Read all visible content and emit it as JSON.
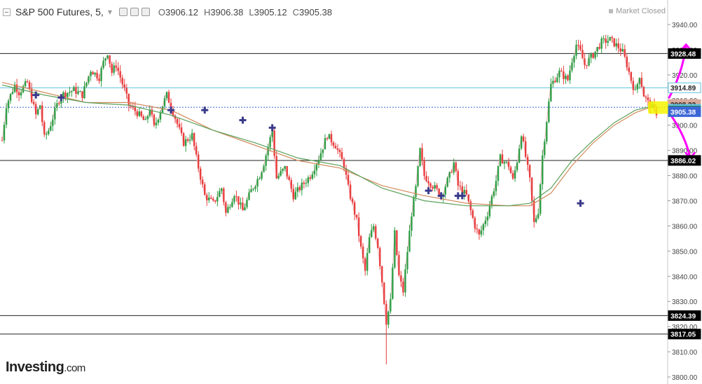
{
  "header": {
    "symbol": "S&P 500 Futures, 5,",
    "caret": "▾",
    "open_key": "O",
    "open": "3906.12",
    "high_key": "H",
    "high": "3906.38",
    "low_key": "L",
    "low": "3905.12",
    "close_key": "C",
    "close": "3905.38",
    "status": "Market Closed"
  },
  "brand": {
    "name": "Investing",
    "suffix": ".com"
  },
  "chart_data": {
    "type": "candlestick",
    "timeframe": "5",
    "ylim": [
      3798,
      3950
    ],
    "y_ticks": [
      "3940.00",
      "3930.00",
      "3920.00",
      "3910.00",
      "3900.00",
      "3890.00",
      "3880.00",
      "3870.00",
      "3860.00",
      "3850.00",
      "3840.00",
      "3830.00",
      "3820.00",
      "3810.00",
      "3800.00"
    ],
    "price_path": [
      [
        0,
        3894
      ],
      [
        1,
        3908
      ],
      [
        3,
        3916
      ],
      [
        4,
        3913
      ],
      [
        6,
        3917
      ],
      [
        8,
        3904
      ],
      [
        9,
        3908
      ],
      [
        10,
        3895
      ],
      [
        11,
        3898
      ],
      [
        13,
        3908
      ],
      [
        14,
        3912
      ],
      [
        17,
        3914
      ],
      [
        19,
        3912
      ],
      [
        21,
        3922
      ],
      [
        23,
        3919
      ],
      [
        24,
        3925
      ],
      [
        25,
        3929
      ],
      [
        26,
        3921
      ],
      [
        27,
        3924
      ],
      [
        29,
        3914
      ],
      [
        30,
        3908
      ],
      [
        32,
        3905
      ],
      [
        34,
        3901
      ],
      [
        35,
        3907
      ],
      [
        36,
        3899
      ],
      [
        38,
        3908
      ],
      [
        39,
        3912
      ],
      [
        41,
        3903
      ],
      [
        43,
        3893
      ],
      [
        45,
        3896
      ],
      [
        46,
        3887
      ],
      [
        48,
        3872
      ],
      [
        50,
        3869
      ],
      [
        52,
        3875
      ],
      [
        53,
        3865
      ],
      [
        55,
        3873
      ],
      [
        57,
        3866
      ],
      [
        59,
        3874
      ],
      [
        61,
        3880
      ],
      [
        62,
        3885
      ],
      [
        64,
        3898
      ],
      [
        65,
        3879
      ],
      [
        67,
        3883
      ],
      [
        69,
        3872
      ],
      [
        71,
        3876
      ],
      [
        73,
        3880
      ],
      [
        75,
        3887
      ],
      [
        77,
        3896
      ],
      [
        79,
        3892
      ],
      [
        81,
        3884
      ],
      [
        82,
        3875
      ],
      [
        84,
        3862
      ],
      [
        85,
        3851
      ],
      [
        86,
        3842
      ],
      [
        87,
        3855
      ],
      [
        88,
        3860
      ],
      [
        89,
        3852
      ],
      [
        90,
        3838
      ],
      [
        91,
        3822
      ],
      [
        92,
        3830
      ],
      [
        93,
        3857
      ],
      [
        94,
        3840
      ],
      [
        95,
        3834
      ],
      [
        96,
        3850
      ],
      [
        97,
        3865
      ],
      [
        98,
        3875
      ],
      [
        99,
        3890
      ],
      [
        100,
        3880
      ],
      [
        102,
        3876
      ],
      [
        104,
        3872
      ],
      [
        106,
        3880
      ],
      [
        107,
        3885
      ],
      [
        108,
        3876
      ],
      [
        110,
        3872
      ],
      [
        111,
        3866
      ],
      [
        112,
        3860
      ],
      [
        113,
        3856
      ],
      [
        115,
        3865
      ],
      [
        117,
        3878
      ],
      [
        118,
        3887
      ],
      [
        120,
        3884
      ],
      [
        121,
        3878
      ],
      [
        122,
        3886
      ],
      [
        123,
        3897
      ],
      [
        125,
        3878
      ],
      [
        126,
        3861
      ],
      [
        127,
        3866
      ],
      [
        128,
        3888
      ],
      [
        129,
        3902
      ],
      [
        130,
        3916
      ],
      [
        132,
        3921
      ],
      [
        134,
        3918
      ],
      [
        135,
        3926
      ],
      [
        136,
        3932
      ],
      [
        137,
        3929
      ],
      [
        138,
        3924
      ],
      [
        140,
        3928
      ],
      [
        142,
        3933
      ],
      [
        144,
        3934
      ],
      [
        146,
        3931
      ],
      [
        147,
        3929
      ],
      [
        148,
        3924
      ],
      [
        149,
        3918
      ],
      [
        150,
        3913
      ],
      [
        151,
        3920
      ],
      [
        152,
        3912
      ],
      [
        153,
        3909
      ],
      [
        154,
        3907
      ],
      [
        155,
        3905
      ]
    ],
    "price_low_spike": {
      "x": 91,
      "low": 3805
    },
    "sma_long": [
      [
        0,
        3917
      ],
      [
        10,
        3913
      ],
      [
        20,
        3909
      ],
      [
        30,
        3909
      ],
      [
        40,
        3906
      ],
      [
        50,
        3898
      ],
      [
        60,
        3892
      ],
      [
        70,
        3886
      ],
      [
        80,
        3883
      ],
      [
        90,
        3876
      ],
      [
        100,
        3872
      ],
      [
        110,
        3869
      ],
      [
        120,
        3868
      ],
      [
        125,
        3868
      ],
      [
        130,
        3873
      ],
      [
        135,
        3884
      ],
      [
        140,
        3893
      ],
      [
        145,
        3900
      ],
      [
        150,
        3905
      ],
      [
        155,
        3908
      ]
    ],
    "sma_short": [
      [
        0,
        3916
      ],
      [
        10,
        3912
      ],
      [
        20,
        3909
      ],
      [
        30,
        3908
      ],
      [
        40,
        3904
      ],
      [
        50,
        3898
      ],
      [
        60,
        3893
      ],
      [
        70,
        3887
      ],
      [
        80,
        3884
      ],
      [
        90,
        3875
      ],
      [
        100,
        3870
      ],
      [
        110,
        3868
      ],
      [
        120,
        3868
      ],
      [
        125,
        3869
      ],
      [
        130,
        3875
      ],
      [
        135,
        3886
      ],
      [
        140,
        3894
      ],
      [
        145,
        3901
      ],
      [
        150,
        3906
      ],
      [
        155,
        3908
      ]
    ],
    "signal_markers": [
      {
        "x": 8,
        "y": 3912
      },
      {
        "x": 14,
        "y": 3911
      },
      {
        "x": 40,
        "y": 3906
      },
      {
        "x": 48,
        "y": 3906
      },
      {
        "x": 57,
        "y": 3902
      },
      {
        "x": 64,
        "y": 3899
      },
      {
        "x": 101,
        "y": 3874
      },
      {
        "x": 104,
        "y": 3872
      },
      {
        "x": 108,
        "y": 3872
      },
      {
        "x": 109,
        "y": 3872
      },
      {
        "x": 137,
        "y": 3869
      }
    ],
    "horizontal_levels": [
      {
        "value": 3928.48,
        "label": "3928.48",
        "style": "solid",
        "color": "#222222",
        "label_bg": "#000000"
      },
      {
        "value": 3914.89,
        "label": "3914.89",
        "style": "solid",
        "color": "#5bc0de",
        "label_bg": "#ffffff",
        "label_color": "#222222",
        "label_border": "#5bc0de"
      },
      {
        "value": 3907.13,
        "label": "3907.13",
        "style": "dotted",
        "color": "#3b66d6",
        "label_bg": "#ff0000"
      },
      {
        "value": 3886.02,
        "label": "3886.02",
        "style": "solid",
        "color": "#222222",
        "label_bg": "#000000"
      },
      {
        "value": 3824.39,
        "label": "3824.39",
        "style": "solid",
        "color": "#222222",
        "label_bg": "#000000"
      },
      {
        "value": 3817.05,
        "label": "3817.05",
        "style": "solid",
        "color": "#222222",
        "label_bg": "#000000"
      }
    ],
    "axis_badges": [
      {
        "value": 3908.22,
        "label": "3908.22",
        "bg": "#d9a99a",
        "color": "#222222"
      },
      {
        "value": 3906.3,
        "label": "3906.30",
        "bg": "#5bc0de",
        "color": "#222222"
      },
      {
        "value": 3905.6,
        "label": "3905.60",
        "bg": "#1e7d1e",
        "color": "#ffffff"
      },
      {
        "value": 3905.38,
        "label": "3905.38",
        "bg": "#3b66d6",
        "color": "#ffffff"
      }
    ],
    "annotations": {
      "highlight": {
        "x_range": [
          153,
          165
        ],
        "y_range": [
          3904.5,
          3909.5
        ],
        "color": "#f5f500"
      },
      "arrows": [
        {
          "direction": "up",
          "color": "#ff00ff",
          "from": [
            158,
            3911
          ],
          "to": [
            162,
            3932
          ]
        },
        {
          "direction": "down",
          "color": "#ff00ff",
          "from": [
            158,
            3905
          ],
          "to": [
            163,
            3887
          ]
        }
      ]
    },
    "colors": {
      "up": "#2e9e44",
      "down": "#e83e3e",
      "sma_long": "#d08a5a",
      "sma_short": "#5aa05a",
      "marker": "#3a3a8a",
      "grid": "#e8e8e8"
    }
  }
}
